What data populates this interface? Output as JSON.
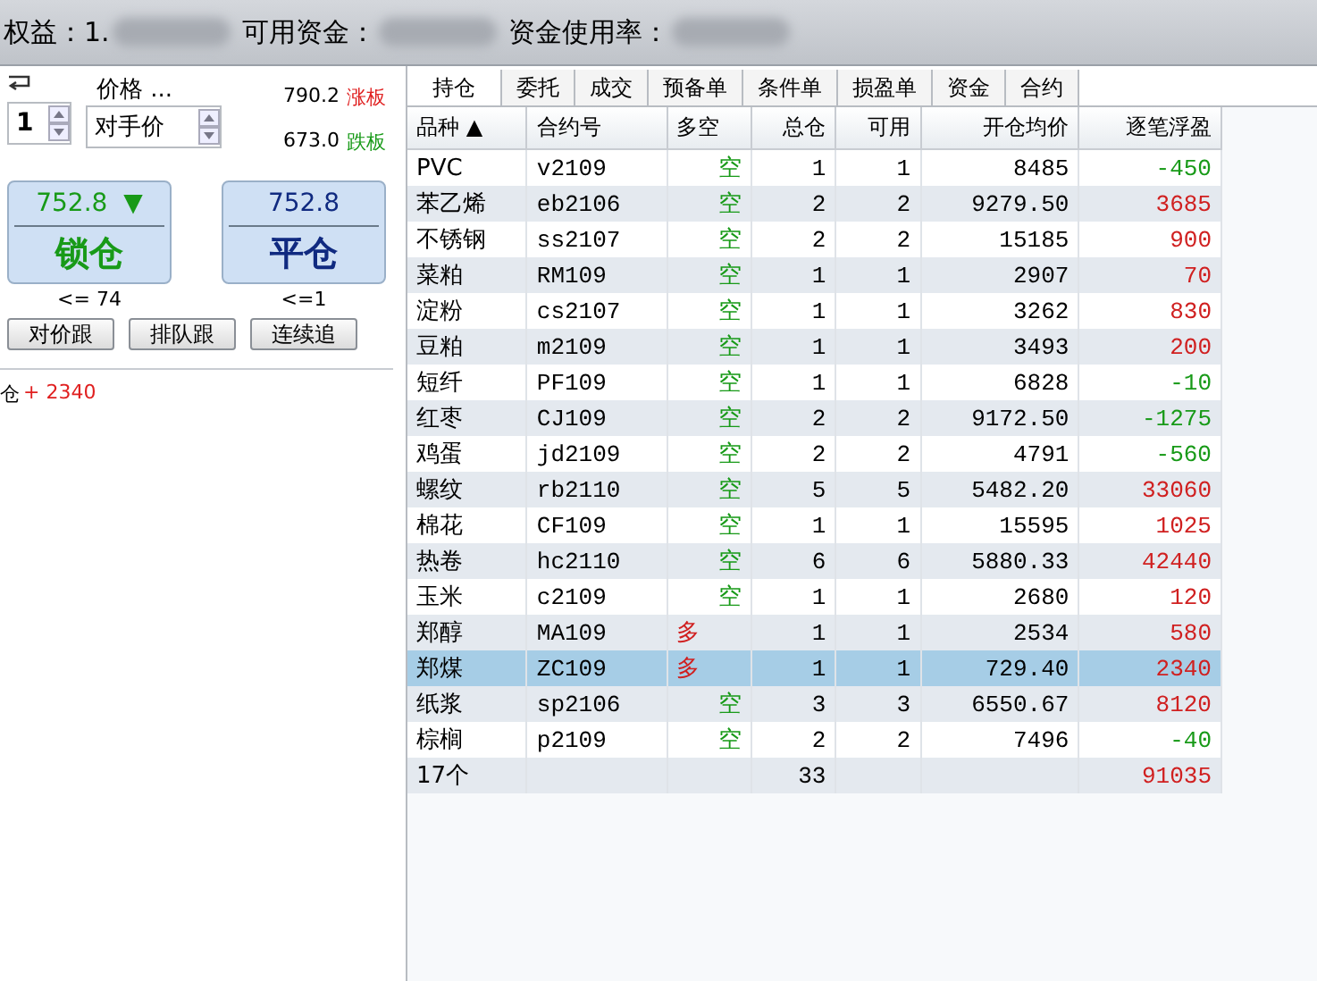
{
  "account_bar": [
    {
      "label": "权益：",
      "value": "1."
    },
    {
      "label": "可用资金："
    },
    {
      "label": "资金使用率："
    }
  ],
  "order_panel": {
    "price_label": "价格 ...",
    "quantity": "1",
    "price_mode": "对手价",
    "limits": [
      {
        "price": "790.2",
        "label": "涨板",
        "kind": "up"
      },
      {
        "price": "673.0",
        "label": "跌板",
        "kind": "down"
      }
    ],
    "actions": [
      {
        "price": "752.8",
        "arrow": "▼",
        "label": "锁仓",
        "limit": "<= 74",
        "kind": "lock"
      },
      {
        "price": "752.8",
        "label": "平仓",
        "limit": "<=1",
        "kind": "close"
      }
    ],
    "follow_buttons": [
      "对价跟",
      "排队跟",
      "连续追"
    ],
    "position_line": {
      "label": "仓",
      "profit": "+ 2340"
    }
  },
  "tabs": [
    {
      "label": "持仓",
      "selected": true
    },
    {
      "label": "委托",
      "selected": false
    },
    {
      "label": "成交",
      "selected": false
    },
    {
      "label": "预备单",
      "selected": false
    },
    {
      "label": "条件单",
      "selected": false
    },
    {
      "label": "损盈单",
      "selected": false
    },
    {
      "label": "资金",
      "selected": false
    },
    {
      "label": "合约",
      "selected": false
    }
  ],
  "table": {
    "columns": [
      "品种 ▲",
      "合约号",
      "多空",
      "总仓",
      "可用",
      "开仓均价",
      "逐笔浮盈"
    ],
    "rows": [
      {
        "name": "PVC",
        "contract": "v2109",
        "side": "空",
        "long": false,
        "total": "1",
        "available": "1",
        "avg_price": "8485",
        "pnl": "-450",
        "profit": false,
        "selected": false
      },
      {
        "name": "苯乙烯",
        "contract": "eb2106",
        "side": "空",
        "long": false,
        "total": "2",
        "available": "2",
        "avg_price": "9279.50",
        "pnl": "3685",
        "profit": true,
        "selected": false
      },
      {
        "name": "不锈钢",
        "contract": "ss2107",
        "side": "空",
        "long": false,
        "total": "2",
        "available": "2",
        "avg_price": "15185",
        "pnl": "900",
        "profit": true,
        "selected": false
      },
      {
        "name": "菜粕",
        "contract": "RM109",
        "side": "空",
        "long": false,
        "total": "1",
        "available": "1",
        "avg_price": "2907",
        "pnl": "70",
        "profit": true,
        "selected": false
      },
      {
        "name": "淀粉",
        "contract": "cs2107",
        "side": "空",
        "long": false,
        "total": "1",
        "available": "1",
        "avg_price": "3262",
        "pnl": "830",
        "profit": true,
        "selected": false
      },
      {
        "name": "豆粕",
        "contract": "m2109",
        "side": "空",
        "long": false,
        "total": "1",
        "available": "1",
        "avg_price": "3493",
        "pnl": "200",
        "profit": true,
        "selected": false
      },
      {
        "name": "短纤",
        "contract": "PF109",
        "side": "空",
        "long": false,
        "total": "1",
        "available": "1",
        "avg_price": "6828",
        "pnl": "-10",
        "profit": false,
        "selected": false
      },
      {
        "name": "红枣",
        "contract": "CJ109",
        "side": "空",
        "long": false,
        "total": "2",
        "available": "2",
        "avg_price": "9172.50",
        "pnl": "-1275",
        "profit": false,
        "selected": false
      },
      {
        "name": "鸡蛋",
        "contract": "jd2109",
        "side": "空",
        "long": false,
        "total": "2",
        "available": "2",
        "avg_price": "4791",
        "pnl": "-560",
        "profit": false,
        "selected": false
      },
      {
        "name": "螺纹",
        "contract": "rb2110",
        "side": "空",
        "long": false,
        "total": "5",
        "available": "5",
        "avg_price": "5482.20",
        "pnl": "33060",
        "profit": true,
        "selected": false
      },
      {
        "name": "棉花",
        "contract": "CF109",
        "side": "空",
        "long": false,
        "total": "1",
        "available": "1",
        "avg_price": "15595",
        "pnl": "1025",
        "profit": true,
        "selected": false
      },
      {
        "name": "热卷",
        "contract": "hc2110",
        "side": "空",
        "long": false,
        "total": "6",
        "available": "6",
        "avg_price": "5880.33",
        "pnl": "42440",
        "profit": true,
        "selected": false
      },
      {
        "name": "玉米",
        "contract": "c2109",
        "side": "空",
        "long": false,
        "total": "1",
        "available": "1",
        "avg_price": "2680",
        "pnl": "120",
        "profit": true,
        "selected": false
      },
      {
        "name": "郑醇",
        "contract": "MA109",
        "side": "多",
        "long": true,
        "total": "1",
        "available": "1",
        "avg_price": "2534",
        "pnl": "580",
        "profit": true,
        "selected": false
      },
      {
        "name": "郑煤",
        "contract": "ZC109",
        "side": "多",
        "long": true,
        "total": "1",
        "available": "1",
        "avg_price": "729.40",
        "pnl": "2340",
        "profit": true,
        "selected": true
      },
      {
        "name": "纸浆",
        "contract": "sp2106",
        "side": "空",
        "long": false,
        "total": "3",
        "available": "3",
        "avg_price": "6550.67",
        "pnl": "8120",
        "profit": true,
        "selected": false
      },
      {
        "name": "棕榈",
        "contract": "p2109",
        "side": "空",
        "long": false,
        "total": "2",
        "available": "2",
        "avg_price": "7496",
        "pnl": "-40",
        "profit": false,
        "selected": false
      }
    ],
    "summary": {
      "name": "17个",
      "total": "33",
      "pnl": "91035"
    }
  }
}
